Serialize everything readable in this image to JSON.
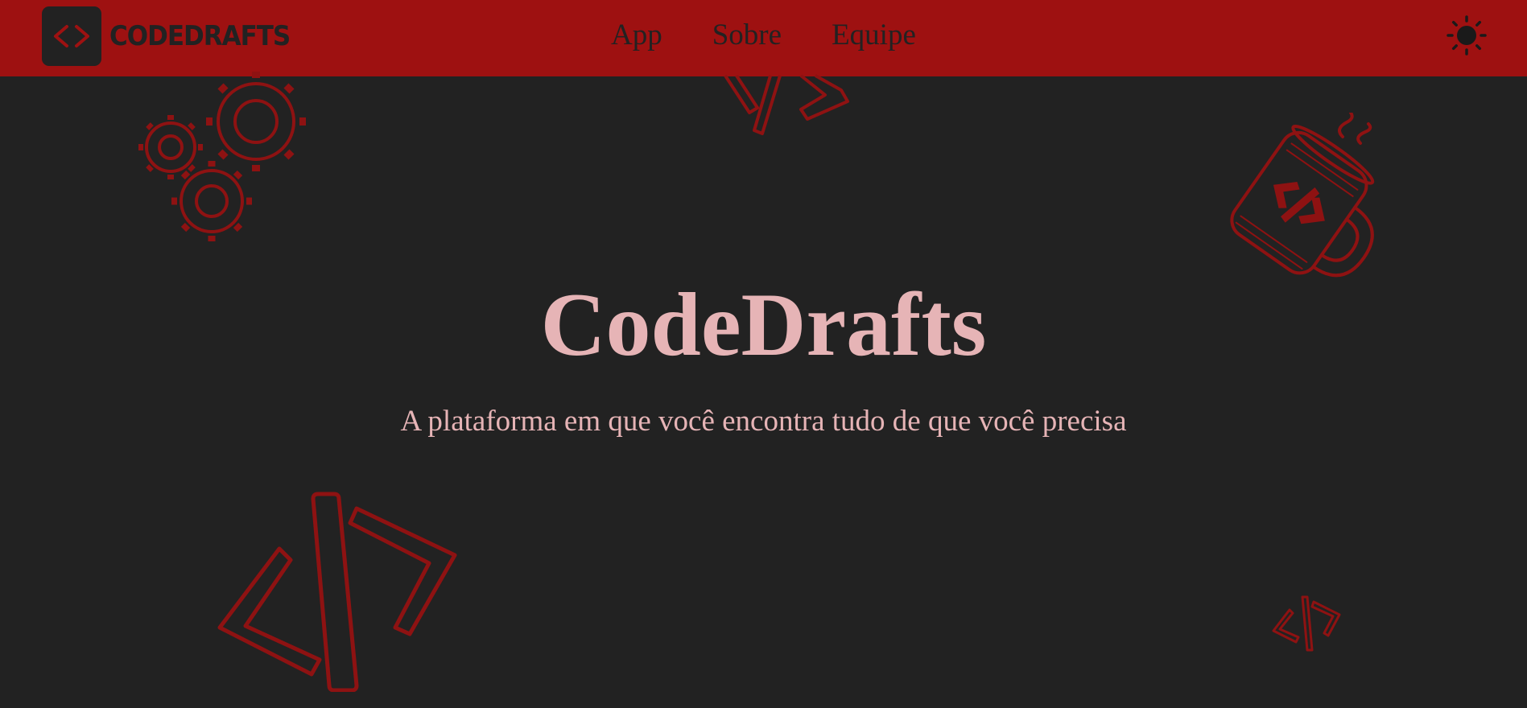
{
  "brand": {
    "name": "CODEDRAFTS",
    "logo_icon": "code-brackets-icon"
  },
  "nav": {
    "items": [
      {
        "label": "App"
      },
      {
        "label": "Sobre"
      },
      {
        "label": "Equipe"
      }
    ]
  },
  "theme_toggle": {
    "icon": "sun-icon"
  },
  "hero": {
    "title": "CodeDrafts",
    "subtitle": "A plataforma em que você encontra tudo de que você precisa"
  },
  "decorations": {
    "icons": [
      "gears-icon",
      "code-slash-icon",
      "coffee-mug-icon",
      "code-slash-icon",
      "code-slash-icon"
    ]
  },
  "colors": {
    "accent": "#9e1111",
    "background": "#222222",
    "hero_text": "#e6b4b6",
    "decoration_stroke": "#8e1212"
  }
}
